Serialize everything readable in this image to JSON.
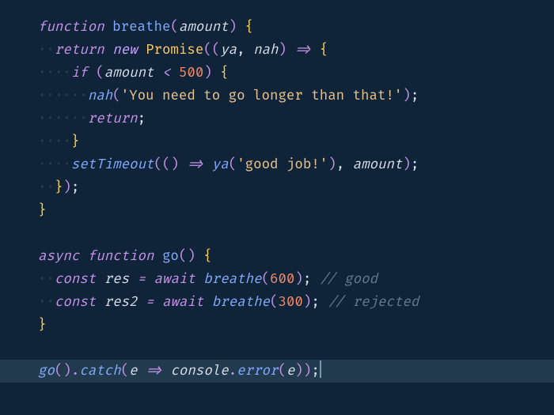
{
  "code": {
    "lines": [
      {
        "n": 1,
        "kind": "code",
        "indent": 0,
        "tokens": [
          {
            "t": "function",
            "c": "kw1"
          },
          {
            "t": " ",
            "c": "pun"
          },
          {
            "t": "breathe",
            "c": "fn"
          },
          {
            "t": "(",
            "c": "par"
          },
          {
            "t": "amount",
            "c": "prm"
          },
          {
            "t": ")",
            "c": "par"
          },
          {
            "t": " ",
            "c": "pun"
          },
          {
            "t": "{",
            "c": "par2"
          }
        ]
      },
      {
        "n": 2,
        "kind": "code",
        "indent": 1,
        "tokens": [
          {
            "t": "return",
            "c": "ret"
          },
          {
            "t": " ",
            "c": "pun"
          },
          {
            "t": "new",
            "c": "new"
          },
          {
            "t": " ",
            "c": "pun"
          },
          {
            "t": "Promise",
            "c": "cls"
          },
          {
            "t": "((",
            "c": "par"
          },
          {
            "t": "ya",
            "c": "prm"
          },
          {
            "t": ",",
            "c": "pun"
          },
          {
            "t": " ",
            "c": "pun"
          },
          {
            "t": "nah",
            "c": "prm"
          },
          {
            "t": ")",
            "c": "par"
          },
          {
            "t": " ",
            "c": "pun"
          },
          {
            "t": "=>",
            "c": "kw2"
          },
          {
            "t": " ",
            "c": "pun"
          },
          {
            "t": "{",
            "c": "par2"
          }
        ]
      },
      {
        "n": 3,
        "kind": "code",
        "indent": 2,
        "tokens": [
          {
            "t": "if",
            "c": "kw2"
          },
          {
            "t": " ",
            "c": "pun"
          },
          {
            "t": "(",
            "c": "par"
          },
          {
            "t": "amount ",
            "c": "prm"
          },
          {
            "t": "<",
            "c": "kw2"
          },
          {
            "t": " ",
            "c": "pun"
          },
          {
            "t": "500",
            "c": "num"
          },
          {
            "t": ")",
            "c": "par"
          },
          {
            "t": " ",
            "c": "pun"
          },
          {
            "t": "{",
            "c": "par2"
          }
        ]
      },
      {
        "n": 4,
        "kind": "code",
        "indent": 3,
        "tokens": [
          {
            "t": "nah",
            "c": "call"
          },
          {
            "t": "(",
            "c": "par"
          },
          {
            "t": "'You need to go longer than that!'",
            "c": "str"
          },
          {
            "t": ")",
            "c": "par"
          },
          {
            "t": ";",
            "c": "pun"
          }
        ]
      },
      {
        "n": 5,
        "kind": "code",
        "indent": 3,
        "tokens": [
          {
            "t": "return",
            "c": "ret"
          },
          {
            "t": ";",
            "c": "pun"
          }
        ]
      },
      {
        "n": 6,
        "kind": "code",
        "indent": 2,
        "tokens": [
          {
            "t": "}",
            "c": "par2"
          }
        ]
      },
      {
        "n": 7,
        "kind": "code",
        "indent": 2,
        "tokens": [
          {
            "t": "setTimeout",
            "c": "call"
          },
          {
            "t": "((",
            "c": "par"
          },
          {
            "t": ")",
            "c": "par"
          },
          {
            "t": " ",
            "c": "pun"
          },
          {
            "t": "=>",
            "c": "kw2"
          },
          {
            "t": " ",
            "c": "pun"
          },
          {
            "t": "ya",
            "c": "call"
          },
          {
            "t": "(",
            "c": "par"
          },
          {
            "t": "'good job!'",
            "c": "str"
          },
          {
            "t": ")",
            "c": "par"
          },
          {
            "t": ",",
            "c": "pun"
          },
          {
            "t": " ",
            "c": "pun"
          },
          {
            "t": "amount",
            "c": "prm"
          },
          {
            "t": ")",
            "c": "par"
          },
          {
            "t": ";",
            "c": "pun"
          }
        ]
      },
      {
        "n": 8,
        "kind": "code",
        "indent": 1,
        "tokens": [
          {
            "t": "}",
            "c": "par2"
          },
          {
            "t": ")",
            "c": "par"
          },
          {
            "t": ";",
            "c": "pun"
          }
        ]
      },
      {
        "n": 9,
        "kind": "code",
        "indent": 0,
        "tokens": [
          {
            "t": "}",
            "c": "par2"
          }
        ]
      },
      {
        "n": 10,
        "kind": "empty"
      },
      {
        "n": 11,
        "kind": "code",
        "indent": 0,
        "tokens": [
          {
            "t": "async",
            "c": "kw1"
          },
          {
            "t": " ",
            "c": "pun"
          },
          {
            "t": "function",
            "c": "kw1"
          },
          {
            "t": " ",
            "c": "pun"
          },
          {
            "t": "go",
            "c": "fn"
          },
          {
            "t": "()",
            "c": "par"
          },
          {
            "t": " ",
            "c": "pun"
          },
          {
            "t": "{",
            "c": "par2"
          }
        ]
      },
      {
        "n": 12,
        "kind": "code",
        "indent": 1,
        "tokens": [
          {
            "t": "const",
            "c": "kw1"
          },
          {
            "t": " ",
            "c": "pun"
          },
          {
            "t": "res",
            "c": "prm"
          },
          {
            "t": " ",
            "c": "pun"
          },
          {
            "t": "=",
            "c": "kw2"
          },
          {
            "t": " ",
            "c": "pun"
          },
          {
            "t": "await",
            "c": "kw2"
          },
          {
            "t": " ",
            "c": "pun"
          },
          {
            "t": "breathe",
            "c": "call"
          },
          {
            "t": "(",
            "c": "par"
          },
          {
            "t": "600",
            "c": "num"
          },
          {
            "t": ")",
            "c": "par"
          },
          {
            "t": ";",
            "c": "pun"
          },
          {
            "t": " ",
            "c": "pun"
          },
          {
            "t": "// good",
            "c": "cmt"
          }
        ]
      },
      {
        "n": 13,
        "kind": "code",
        "indent": 1,
        "tokens": [
          {
            "t": "const",
            "c": "kw1"
          },
          {
            "t": " ",
            "c": "pun"
          },
          {
            "t": "res2",
            "c": "prm"
          },
          {
            "t": " ",
            "c": "pun"
          },
          {
            "t": "=",
            "c": "kw2"
          },
          {
            "t": " ",
            "c": "pun"
          },
          {
            "t": "await",
            "c": "kw2"
          },
          {
            "t": " ",
            "c": "pun"
          },
          {
            "t": "breathe",
            "c": "call"
          },
          {
            "t": "(",
            "c": "par"
          },
          {
            "t": "300",
            "c": "num"
          },
          {
            "t": ")",
            "c": "par"
          },
          {
            "t": ";",
            "c": "pun"
          },
          {
            "t": " ",
            "c": "pun"
          },
          {
            "t": "// rejected",
            "c": "cmt"
          }
        ]
      },
      {
        "n": 14,
        "kind": "code",
        "indent": 0,
        "tokens": [
          {
            "t": "}",
            "c": "par2"
          }
        ]
      },
      {
        "n": 15,
        "kind": "empty"
      },
      {
        "n": 16,
        "kind": "code",
        "highlighted": true,
        "cursor": true,
        "indent": 0,
        "tokens": [
          {
            "t": "go",
            "c": "call"
          },
          {
            "t": "()",
            "c": "par"
          },
          {
            "t": ".",
            "c": "dot"
          },
          {
            "t": "catch",
            "c": "call"
          },
          {
            "t": "(",
            "c": "par"
          },
          {
            "t": "e",
            "c": "prm"
          },
          {
            "t": " ",
            "c": "pun"
          },
          {
            "t": "=>",
            "c": "kw2"
          },
          {
            "t": " ",
            "c": "pun"
          },
          {
            "t": "console",
            "c": "prm"
          },
          {
            "t": ".",
            "c": "dot"
          },
          {
            "t": "error",
            "c": "call"
          },
          {
            "t": "(",
            "c": "par"
          },
          {
            "t": "e",
            "c": "prm"
          },
          {
            "t": "))",
            "c": "par"
          },
          {
            "t": ";",
            "c": "pun"
          }
        ]
      }
    ],
    "tabSize": 2
  }
}
